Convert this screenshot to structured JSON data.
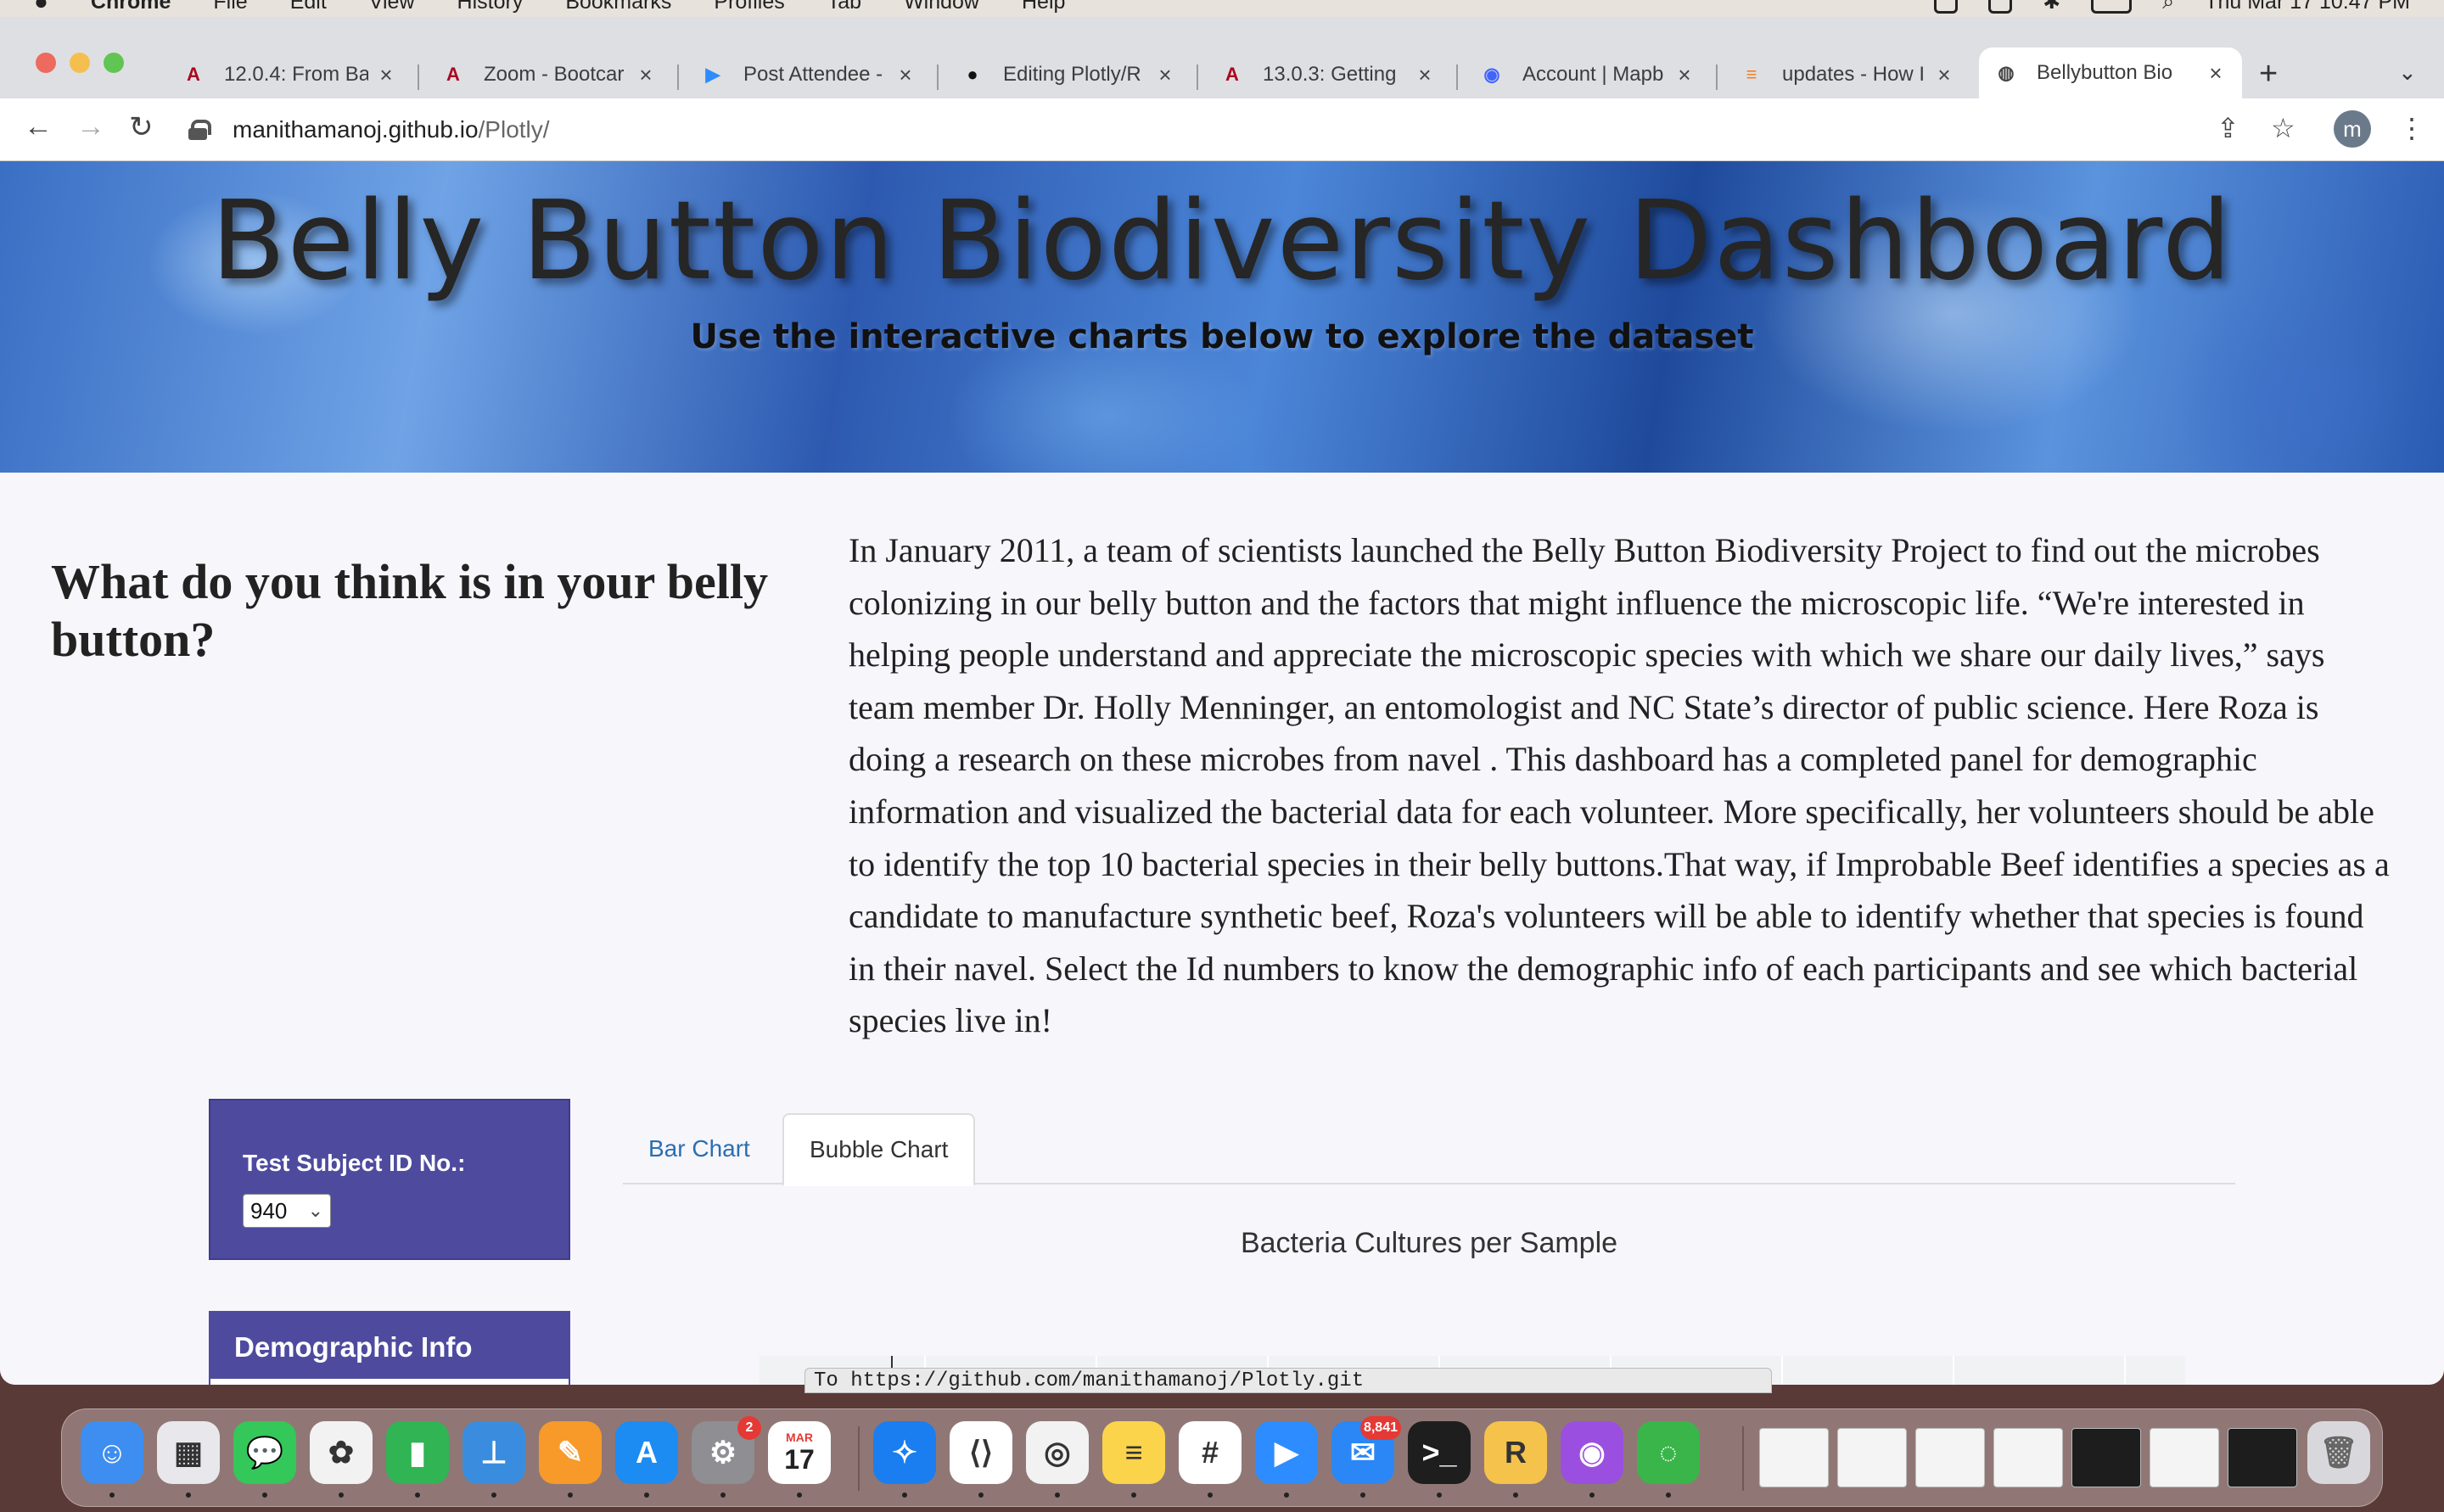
{
  "menubar": {
    "app": "Chrome",
    "items": [
      "File",
      "Edit",
      "View",
      "History",
      "Bookmarks",
      "Profiles",
      "Tab",
      "Window",
      "Help"
    ],
    "datetime": "Thu Mar 17  10:47 PM"
  },
  "tabs": [
    {
      "title": "12.0.4: From Ba",
      "icon": "arizona-logo-icon",
      "glyph": "A",
      "color": "#ab0520"
    },
    {
      "title": "Zoom - Bootcar",
      "icon": "arizona-logo-icon",
      "glyph": "A",
      "color": "#ab0520"
    },
    {
      "title": "Post Attendee -",
      "icon": "zoom-icon",
      "glyph": "▶",
      "color": "#2d8cff"
    },
    {
      "title": "Editing Plotly/R",
      "icon": "github-icon",
      "glyph": "●",
      "color": "#111111"
    },
    {
      "title": "13.0.3: Getting",
      "icon": "arizona-logo-icon",
      "glyph": "A",
      "color": "#ab0520"
    },
    {
      "title": "Account | Mapb",
      "icon": "mapbox-icon",
      "glyph": "◉",
      "color": "#4264fb"
    },
    {
      "title": "updates - How I",
      "icon": "stackoverflow-icon",
      "glyph": "≡",
      "color": "#f48024"
    },
    {
      "title": "Bellybutton Bio",
      "icon": "globe-icon",
      "glyph": "◍",
      "color": "#444444"
    }
  ],
  "address": {
    "host": "manithamanoj.github.io",
    "path": "/Plotly/",
    "avatar": "m"
  },
  "banner": {
    "title": "Belly Button Biodiversity Dashboard",
    "subtitle": "Use the interactive charts below to explore the dataset"
  },
  "intro": {
    "question": "What do you think is in your belly button?",
    "text": "In January 2011, a team of scientists launched the Belly Button Biodiversity Project to find out the microbes colonizing in our belly button and the factors that might influence the microscopic life. “We're interested in helping people understand and appreciate the microscopic species with which we share our daily lives,” says team member Dr. Holly Menninger, an entomologist and NC State’s director of public science.  Here Roza is doing a research on these microbes from navel . This dashboard has a completed panel for demographic information and visualized the bacterial data for each volunteer. More specifically, her volunteers should be able to identify the top 10 bacterial species in their belly buttons.That way, if Improbable Beef identifies a species as a candidate to manufacture synthetic beef, Roza's volunteers will be able to identify whether that species is found in their navel. Select the Id numbers to know the demographic info of each participants and see which bacterial species live in!"
  },
  "selector": {
    "label": "Test Subject ID No.:",
    "value": "940"
  },
  "demographic": {
    "header": "Demographic Info"
  },
  "chart_tabs": {
    "bar": "Bar Chart",
    "bubble": "Bubble Chart",
    "active": "bubble"
  },
  "chart": {
    "title": "Bacteria Cultures per Sample"
  },
  "status_bar": "To https://github.com/manithamanoj/Plotly.git",
  "dock": [
    {
      "name": "finder-icon",
      "color": "#3d8ef0",
      "glyph": "☺"
    },
    {
      "name": "launchpad-icon",
      "color": "#e8e8ec",
      "glyph": "▦"
    },
    {
      "name": "messages-icon",
      "color": "#34c759",
      "glyph": "💬"
    },
    {
      "name": "photos-icon",
      "color": "#f2f2f2",
      "glyph": "✿"
    },
    {
      "name": "numbers-icon",
      "color": "#30b454",
      "glyph": "▮"
    },
    {
      "name": "keynote-icon",
      "color": "#3a8dde",
      "glyph": "⊥"
    },
    {
      "name": "pages-icon",
      "color": "#f79a2a",
      "glyph": "✎"
    },
    {
      "name": "app-store-icon",
      "color": "#1c8cf2",
      "glyph": "A"
    },
    {
      "name": "system-preferences-icon",
      "color": "#8e8e93",
      "glyph": "⚙",
      "badge": "2"
    },
    {
      "name": "calendar-icon",
      "color": "#ffffff",
      "glyph": "17"
    },
    {
      "name": "safari-icon",
      "color": "#1a7ef0",
      "glyph": "✧"
    },
    {
      "name": "vscode-icon",
      "color": "#ffffff",
      "glyph": "⟨⟩"
    },
    {
      "name": "chrome-icon",
      "color": "#f2f2f2",
      "glyph": "◎"
    },
    {
      "name": "notes-icon",
      "color": "#fbd44b",
      "glyph": "≡"
    },
    {
      "name": "slack-icon",
      "color": "#ffffff",
      "glyph": "#"
    },
    {
      "name": "zoom-icon",
      "color": "#2d8cff",
      "glyph": "▶"
    },
    {
      "name": "mail-icon",
      "color": "#2a87f5",
      "glyph": "✉",
      "badge": "8,841"
    },
    {
      "name": "terminal-icon",
      "color": "#1e1e1e",
      "glyph": ">_"
    },
    {
      "name": "rstudio-icon",
      "color": "#f5c24b",
      "glyph": "R"
    },
    {
      "name": "podcasts-icon",
      "color": "#9b4fe0",
      "glyph": "◉"
    },
    {
      "name": "activity-icon",
      "color": "#3ab54a",
      "glyph": "◌"
    }
  ],
  "calendar_month": "MAR"
}
